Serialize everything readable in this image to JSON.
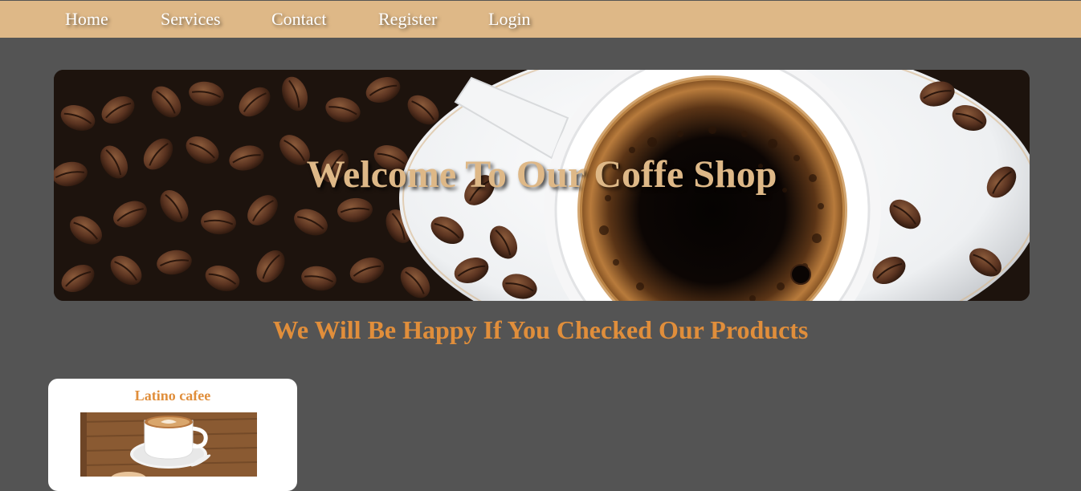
{
  "nav": {
    "items": [
      {
        "label": "Home"
      },
      {
        "label": "Services"
      },
      {
        "label": "Contact"
      },
      {
        "label": "Register"
      },
      {
        "label": "Login"
      }
    ]
  },
  "hero": {
    "title": "Welcome To Our Coffe Shop"
  },
  "tagline": "We Will Be Happy If You Checked Our Products",
  "products": [
    {
      "name": "Latino cafee"
    }
  ],
  "colors": {
    "background": "#545454",
    "navbar": "#deb887",
    "hero_title": "#deb887",
    "accent": "#e08e3b"
  }
}
